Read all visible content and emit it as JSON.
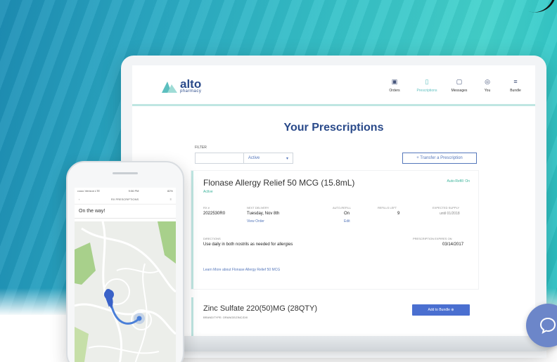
{
  "app": {
    "logo_name": "alto",
    "logo_sub": "pharmacy",
    "nav": [
      {
        "label": "Orders",
        "icon": "orders-icon"
      },
      {
        "label": "Prescriptions",
        "icon": "prescriptions-icon"
      },
      {
        "label": "Messages",
        "icon": "messages-icon"
      },
      {
        "label": "You",
        "icon": "user-icon"
      },
      {
        "label": "Bundle",
        "icon": "bundle-icon"
      }
    ],
    "page_title": "Your Prescriptions",
    "filter": {
      "label": "FILTER",
      "value": "Active"
    },
    "transfer_button": "+ Transfer a Prescription",
    "prescriptions": [
      {
        "name": "Flonase Allergy Relief 50 MCG (15.8mL)",
        "status": "Active",
        "auto_refill": "Auto-Refill: On",
        "rx_num_label": "RX #",
        "rx_num": "2022530R0",
        "next_delivery_label": "NEXT DELIVERY",
        "next_delivery": "Tuesday, Nov 8th",
        "view_order": "View Order",
        "autorefill_label": "AUTO-REFILL",
        "autorefill_value": "On",
        "edit": "Edit",
        "refills_left_label": "REFILLS LEFT",
        "refills_left": "9",
        "expected_supply_label": "EXPECTED SUPPLY",
        "expected_supply": "until 01/2018",
        "directions_label": "DIRECTIONS",
        "directions": "Use daily in both nostrils as needed for allergies",
        "expires_label": "PRESCRIPTION EXPIRES ON",
        "expires": "03/14/2017",
        "learn_more": "Learn More about Flonase Allergy Relief 50 MCG"
      },
      {
        "name": "Zinc Sulfate 220(50)MG (28QTY)",
        "sub": "BRAND/TYPE: ORANGE/ZINC/DIX",
        "button": "Add to Bundle"
      }
    ]
  },
  "phone": {
    "status_left": "••ooo Verizon LTE",
    "status_time": "9:06 PM",
    "status_right": "82%",
    "nav_left": "‹",
    "nav_title": "RX PRESCRIPTIONS",
    "nav_right": "≡",
    "on_the_way": "On the way!"
  },
  "colors": {
    "brand": "#2a4a8a",
    "accent": "#5cbfbf",
    "link": "#5577bb",
    "primary_button": "#4a6fd0",
    "active_green": "#3bb39a"
  }
}
